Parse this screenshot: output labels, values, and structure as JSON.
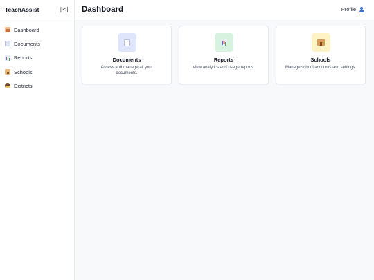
{
  "app": {
    "name": "TeachAssist",
    "collapse_label": "|<|"
  },
  "sidebar": {
    "items": [
      {
        "label": "Dashboard",
        "icon": "house-icon"
      },
      {
        "label": "Documents",
        "icon": "document-icon"
      },
      {
        "label": "Reports",
        "icon": "bar-chart-icon"
      },
      {
        "label": "Schools",
        "icon": "school-icon"
      },
      {
        "label": "Districts",
        "icon": "teacher-icon"
      }
    ]
  },
  "header": {
    "title": "Dashboard",
    "profile_label": "Profile",
    "profile_icon": "user-icon"
  },
  "cards": [
    {
      "title": "Documents",
      "description": "Access and manage all your documents.",
      "icon": "document-icon",
      "icon_bg": "#dfe6fb"
    },
    {
      "title": "Reports",
      "description": "View analytics and usage reports.",
      "icon": "bar-chart-icon",
      "icon_bg": "#d7f3e0"
    },
    {
      "title": "Schools",
      "description": "Manage school accounts and settings.",
      "icon": "school-icon",
      "icon_bg": "#fdf3c4"
    }
  ]
}
